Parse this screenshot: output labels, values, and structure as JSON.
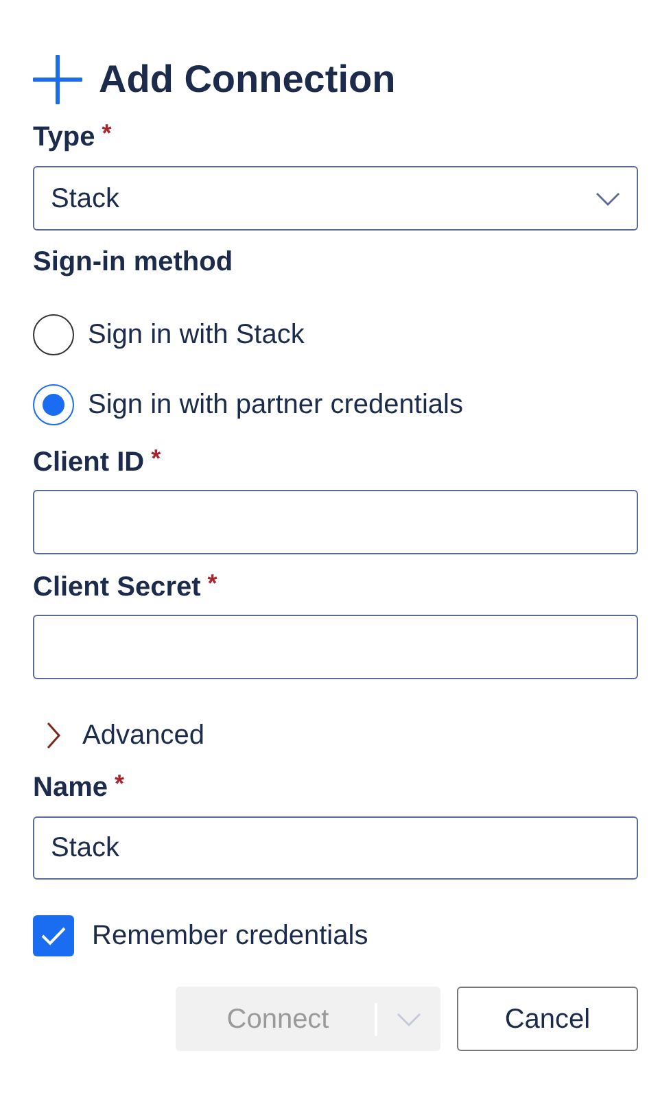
{
  "title": "Add Connection",
  "type_field": {
    "label": "Type",
    "required_mark": "*",
    "value": "Stack"
  },
  "sign_in": {
    "label": "Sign-in method",
    "options": [
      {
        "label": "Sign in with Stack",
        "selected": false
      },
      {
        "label": "Sign in with partner credentials",
        "selected": true
      }
    ]
  },
  "client_id": {
    "label": "Client ID",
    "required_mark": "*"
  },
  "client_secret": {
    "label": "Client Secret",
    "required_mark": "*"
  },
  "advanced": {
    "label": "Advanced",
    "expanded": false
  },
  "name_field": {
    "label": "Name",
    "required_mark": "*",
    "value": "Stack"
  },
  "remember": {
    "label": "Remember credentials",
    "checked": true
  },
  "buttons": [
    {
      "label": "Connect",
      "kind": "split",
      "disabled": true
    },
    {
      "label": "Cancel",
      "kind": "plain",
      "disabled": false
    }
  ]
}
